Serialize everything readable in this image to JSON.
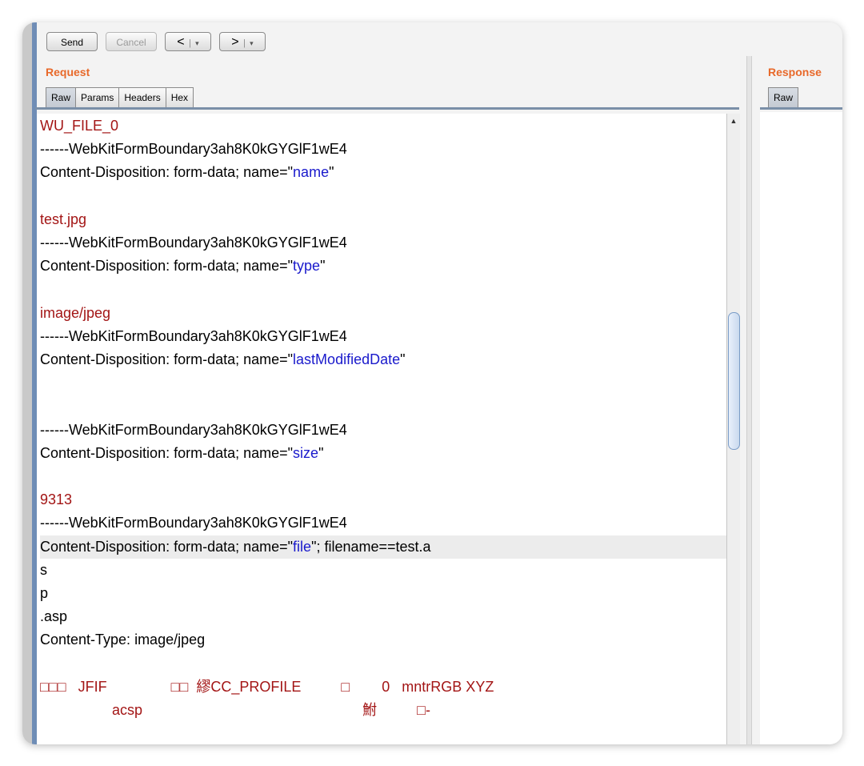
{
  "toolbar": {
    "send_label": "Send",
    "cancel_label": "Cancel",
    "back_label": "<",
    "forward_label": ">",
    "dropdown_glyph": "▾",
    "separator": "|"
  },
  "request": {
    "label": "Request",
    "tabs": [
      {
        "label": "Raw",
        "active": true
      },
      {
        "label": "Params",
        "active": false
      },
      {
        "label": "Headers",
        "active": false
      },
      {
        "label": "Hex",
        "active": false
      }
    ],
    "lines": [
      {
        "segments": [
          {
            "text": "WU_FILE_0",
            "color": "red"
          }
        ]
      },
      {
        "segments": [
          {
            "text": "------WebKitFormBoundary3ah8K0kGYGlF1wE4",
            "color": "black"
          }
        ]
      },
      {
        "segments": [
          {
            "text": "Content-Disposition: form-data; name=\"",
            "color": "black"
          },
          {
            "text": "name",
            "color": "blue"
          },
          {
            "text": "\"",
            "color": "black"
          }
        ]
      },
      {
        "segments": []
      },
      {
        "segments": [
          {
            "text": "test.jpg",
            "color": "red"
          }
        ]
      },
      {
        "segments": [
          {
            "text": "------WebKitFormBoundary3ah8K0kGYGlF1wE4",
            "color": "black"
          }
        ]
      },
      {
        "segments": [
          {
            "text": "Content-Disposition: form-data; name=\"",
            "color": "black"
          },
          {
            "text": "type",
            "color": "blue"
          },
          {
            "text": "\"",
            "color": "black"
          }
        ]
      },
      {
        "segments": []
      },
      {
        "segments": [
          {
            "text": "image/jpeg",
            "color": "red"
          }
        ]
      },
      {
        "segments": [
          {
            "text": "------WebKitFormBoundary3ah8K0kGYGlF1wE4",
            "color": "black"
          }
        ]
      },
      {
        "segments": [
          {
            "text": "Content-Disposition: form-data; name=\"",
            "color": "black"
          },
          {
            "text": "lastModifiedDate",
            "color": "blue"
          },
          {
            "text": "\"",
            "color": "black"
          }
        ]
      },
      {
        "segments": []
      },
      {
        "segments": []
      },
      {
        "segments": [
          {
            "text": "------WebKitFormBoundary3ah8K0kGYGlF1wE4",
            "color": "black"
          }
        ]
      },
      {
        "segments": [
          {
            "text": "Content-Disposition: form-data; name=\"",
            "color": "black"
          },
          {
            "text": "size",
            "color": "blue"
          },
          {
            "text": "\"",
            "color": "black"
          }
        ]
      },
      {
        "segments": []
      },
      {
        "segments": [
          {
            "text": "9313",
            "color": "red"
          }
        ]
      },
      {
        "segments": [
          {
            "text": "------WebKitFormBoundary3ah8K0kGYGlF1wE4",
            "color": "black"
          }
        ]
      },
      {
        "highlight": true,
        "segments": [
          {
            "text": "Content-Disposition: form-data; name=\"",
            "color": "black"
          },
          {
            "text": "file",
            "color": "blue"
          },
          {
            "text": "\"; filename==test.a",
            "color": "black"
          }
        ]
      },
      {
        "segments": [
          {
            "text": "s",
            "color": "black"
          }
        ]
      },
      {
        "segments": [
          {
            "text": "p",
            "color": "black"
          }
        ]
      },
      {
        "segments": [
          {
            "text": ".asp",
            "color": "black"
          }
        ]
      },
      {
        "segments": [
          {
            "text": "Content-Type: image/jpeg",
            "color": "black"
          }
        ]
      },
      {
        "segments": []
      },
      {
        "segments": [
          {
            "text": "□□□   JFIF                □□  繆CC_PROFILE          □        0   mntrRGB XYZ",
            "color": "red"
          }
        ]
      },
      {
        "segments": [
          {
            "text": "                  acsp                                                       鮒          □-",
            "color": "red"
          }
        ]
      }
    ]
  },
  "response": {
    "label": "Response",
    "tabs": [
      {
        "label": "Raw",
        "active": true
      }
    ]
  },
  "colors": {
    "section_label": "#e8692a",
    "value_red": "#a31515",
    "param_blue": "#1a1acc"
  }
}
